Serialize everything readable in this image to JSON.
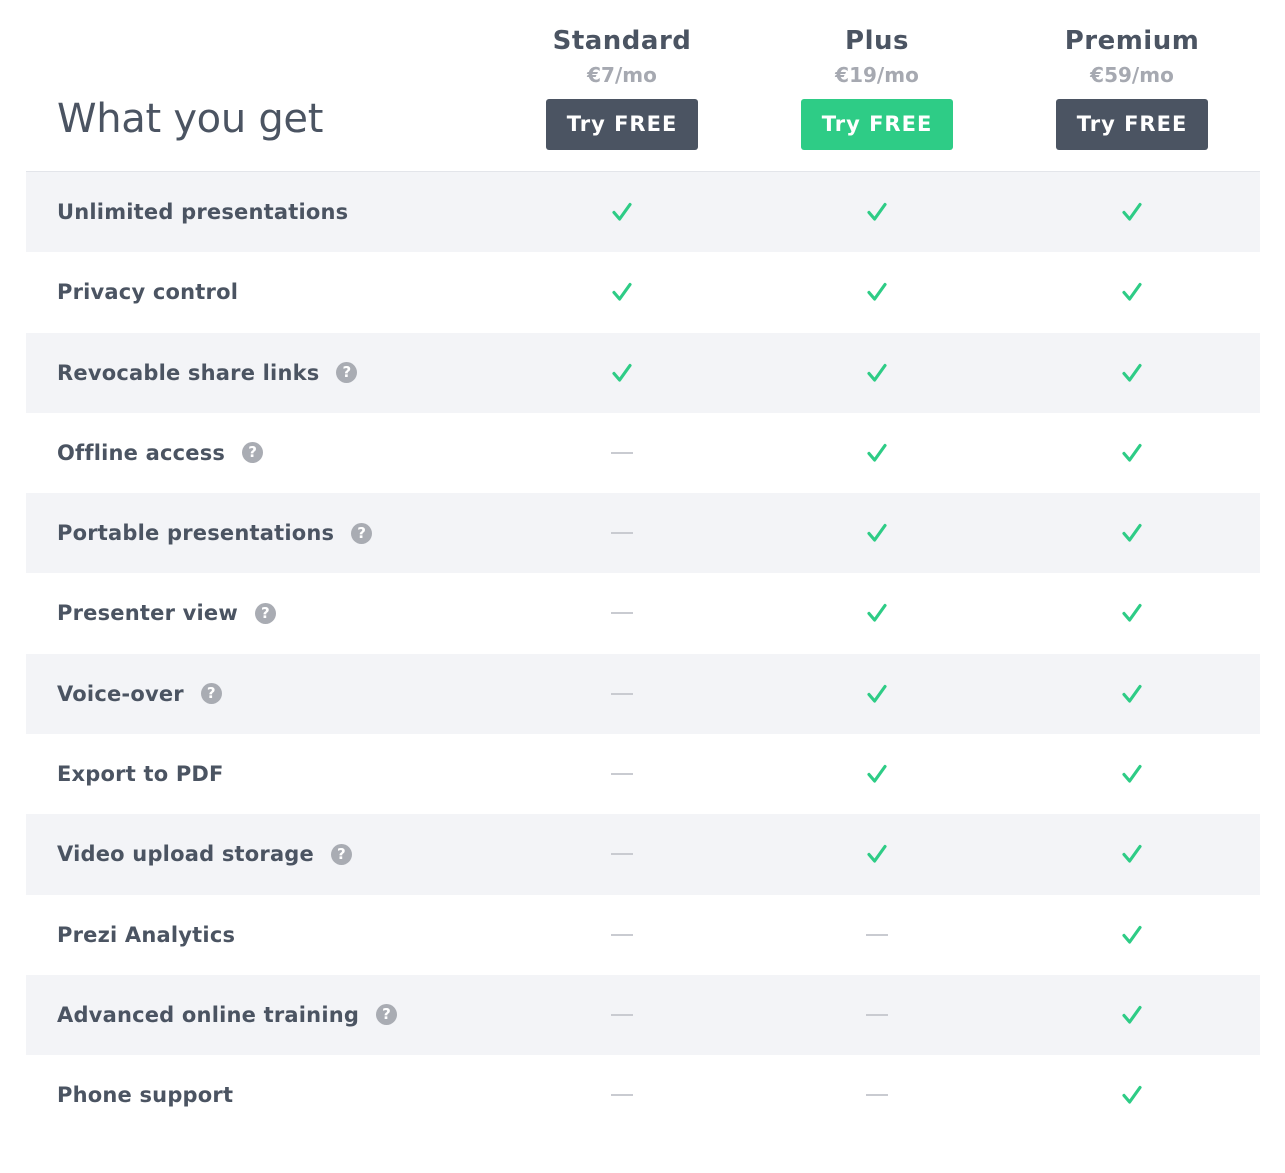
{
  "header": {
    "title": "What you get"
  },
  "plans": [
    {
      "name": "Standard",
      "price": "€7/mo",
      "button": "Try FREE",
      "highlight": false
    },
    {
      "name": "Plus",
      "price": "€19/mo",
      "button": "Try FREE",
      "highlight": true
    },
    {
      "name": "Premium",
      "price": "€59/mo",
      "button": "Try FREE",
      "highlight": false
    }
  ],
  "colors": {
    "text": "#4b5462",
    "muted": "#a6a9b1",
    "accent_green": "#2ecc86",
    "dark_button": "#4b5462",
    "row_shade": "#f3f4f7"
  },
  "icons": {
    "included": "check-icon",
    "not_included": "dash-icon",
    "help": "help-icon"
  },
  "features": [
    {
      "label": "Unlimited presentations",
      "help": false,
      "included": [
        true,
        true,
        true
      ]
    },
    {
      "label": "Privacy control",
      "help": false,
      "included": [
        true,
        true,
        true
      ]
    },
    {
      "label": "Revocable share links",
      "help": true,
      "included": [
        true,
        true,
        true
      ]
    },
    {
      "label": "Offline access",
      "help": true,
      "included": [
        false,
        true,
        true
      ]
    },
    {
      "label": "Portable presentations",
      "help": true,
      "included": [
        false,
        true,
        true
      ]
    },
    {
      "label": "Presenter view",
      "help": true,
      "included": [
        false,
        true,
        true
      ]
    },
    {
      "label": "Voice-over",
      "help": true,
      "included": [
        false,
        true,
        true
      ]
    },
    {
      "label": "Export to PDF",
      "help": false,
      "included": [
        false,
        true,
        true
      ]
    },
    {
      "label": "Video upload storage",
      "help": true,
      "included": [
        false,
        true,
        true
      ]
    },
    {
      "label": "Prezi Analytics",
      "help": false,
      "included": [
        false,
        false,
        true
      ]
    },
    {
      "label": "Advanced online training",
      "help": true,
      "included": [
        false,
        false,
        true
      ]
    },
    {
      "label": "Phone support",
      "help": false,
      "included": [
        false,
        false,
        true
      ]
    }
  ]
}
